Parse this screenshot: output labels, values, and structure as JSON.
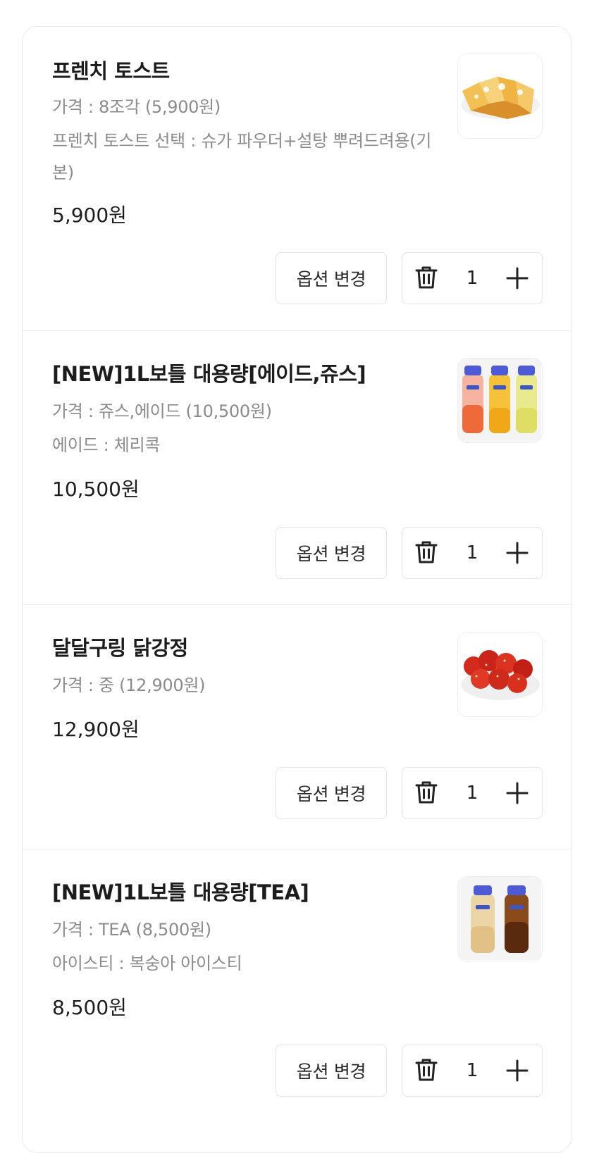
{
  "cart": {
    "items": [
      {
        "name": "프렌치 토스트",
        "options": [
          "가격 : 8조각 (5,900원)",
          "프렌치 토스트 선택 : 슈가 파우더+설탕 뿌려드려용(기본)"
        ],
        "price": "5,900원",
        "image": "french-toast-image",
        "option_button": "옵션 변경",
        "quantity": "1"
      },
      {
        "name": "[NEW]1L보틀 대용량[에이드,쥬스]",
        "options": [
          "가격 : 쥬스,에이드 (10,500원)",
          "에이드 : 체리콕"
        ],
        "price": "10,500원",
        "image": "juice-bottles-image",
        "option_button": "옵션 변경",
        "quantity": "1"
      },
      {
        "name": "달달구링 닭강정",
        "options": [
          "가격 : 중 (12,900원)"
        ],
        "price": "12,900원",
        "image": "dakgangjeong-image",
        "option_button": "옵션 변경",
        "quantity": "1"
      },
      {
        "name": "[NEW]1L보틀 대용량[TEA]",
        "options": [
          "가격 : TEA (8,500원)",
          "아이스티 : 복숭아 아이스티"
        ],
        "price": "8,500원",
        "image": "tea-bottles-image",
        "option_button": "옵션 변경",
        "quantity": "1"
      }
    ]
  },
  "icons": {
    "delete": "trash-icon",
    "increase": "plus-icon"
  },
  "colors": {
    "text_primary": "#1c1c1c",
    "text_secondary": "#8b8b8b",
    "border": "#e3e3e3"
  }
}
